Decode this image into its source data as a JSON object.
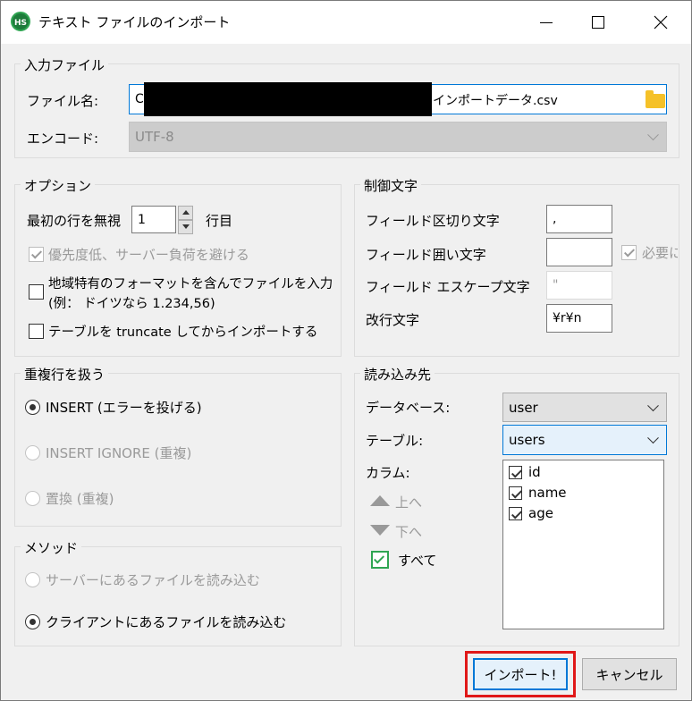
{
  "window": {
    "title": "テキスト ファイルのインポート",
    "app_icon_text": "HS"
  },
  "input_file": {
    "group_label": "入力ファイル",
    "filename_label": "ファイル名:",
    "filename_prefix": "C",
    "filename_suffix": "インポートデータ.csv",
    "encode_label": "エンコード:",
    "encode_value": "UTF-8"
  },
  "options": {
    "group_label": "オプション",
    "first_row_label": "最初の行を無視",
    "first_row_value": "1",
    "first_row_unit": "行目",
    "low_priority_label": "優先度低、サーバー負荷を避ける",
    "low_priority_checked": true,
    "locale_format_line1": "地域特有のフォーマットを含んでファイルを入力",
    "locale_format_line2": "(例： ドイツなら 1.234,56)",
    "locale_format_checked": false,
    "truncate_label": "テーブルを truncate してからインポートする",
    "truncate_checked": false
  },
  "control_chars": {
    "group_label": "制御文字",
    "field_sep_label": "フィールド区切り文字",
    "field_sep_value": ",",
    "field_enclose_label": "フィールド囲い文字",
    "field_enclose_value": "",
    "required_label": "必要に",
    "required_checked": true,
    "field_escape_label": "フィールド エスケープ文字",
    "field_escape_value": "\"",
    "line_break_label": "改行文字",
    "line_break_value": "¥r¥n"
  },
  "duplicates": {
    "group_label": "重複行を扱う",
    "options": [
      {
        "label": "INSERT (エラーを投げる)",
        "selected": true,
        "enabled": true
      },
      {
        "label": "INSERT IGNORE (重複)",
        "selected": false,
        "enabled": false
      },
      {
        "label": "置換 (重複)",
        "selected": false,
        "enabled": false
      }
    ]
  },
  "method": {
    "group_label": "メソッド",
    "options": [
      {
        "label": "サーバーにあるファイルを読み込む",
        "selected": false,
        "enabled": false
      },
      {
        "label": "クライアントにあるファイルを読み込む",
        "selected": true,
        "enabled": true
      }
    ]
  },
  "destination": {
    "group_label": "読み込み先",
    "database_label": "データベース:",
    "database_value": "user",
    "table_label": "テーブル:",
    "table_value": "users",
    "columns_label": "カラム:",
    "move_up_label": "上へ",
    "move_down_label": "下へ",
    "all_label": "すべて",
    "all_checked": true,
    "columns": [
      {
        "name": "id",
        "checked": true
      },
      {
        "name": "name",
        "checked": true
      },
      {
        "name": "age",
        "checked": true
      }
    ]
  },
  "footer": {
    "import_label": "インポート!",
    "cancel_label": "キャンセル"
  },
  "colors": {
    "accent": "#0078d7",
    "highlight": "#e01818",
    "check_green": "#2fa552",
    "folder": "#f5c128"
  }
}
